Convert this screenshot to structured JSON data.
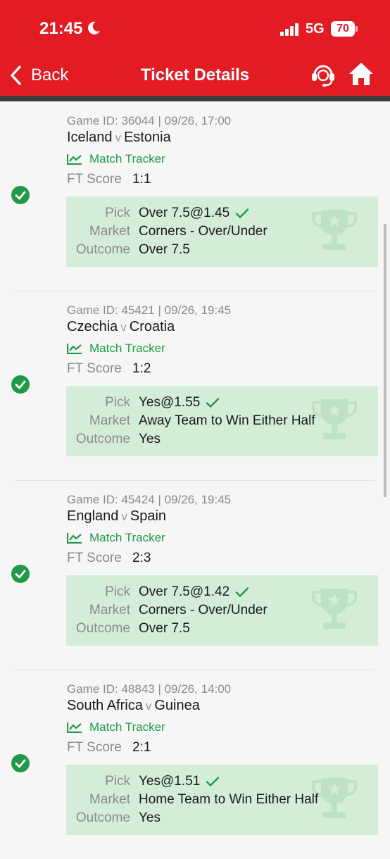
{
  "status_bar": {
    "time": "21:45",
    "network": "5G",
    "battery": "70"
  },
  "header": {
    "back_label": "Back",
    "title": "Ticket Details"
  },
  "bets": [
    {
      "game_info": "Game ID: 36044 | 09/26, 17:00",
      "home": "Iceland",
      "vs": "v",
      "away": "Estonia",
      "tracker_label": "Match Tracker",
      "ft_label": "FT Score",
      "ft_score": "1:1",
      "pick_label": "Pick",
      "pick": "Over 7.5@1.45",
      "market_label": "Market",
      "market": "Corners - Over/Under",
      "outcome_label": "Outcome",
      "outcome": "Over 7.5"
    },
    {
      "game_info": "Game ID: 45421 | 09/26, 19:45",
      "home": "Czechia",
      "vs": "v",
      "away": "Croatia",
      "tracker_label": "Match Tracker",
      "ft_label": "FT Score",
      "ft_score": "1:2",
      "pick_label": "Pick",
      "pick": "Yes@1.55",
      "market_label": "Market",
      "market": "Away Team to Win Either Half",
      "outcome_label": "Outcome",
      "outcome": "Yes"
    },
    {
      "game_info": "Game ID: 45424 | 09/26, 19:45",
      "home": "England",
      "vs": "v",
      "away": "Spain",
      "tracker_label": "Match Tracker",
      "ft_label": "FT Score",
      "ft_score": "2:3",
      "pick_label": "Pick",
      "pick": "Over 7.5@1.42",
      "market_label": "Market",
      "market": "Corners - Over/Under",
      "outcome_label": "Outcome",
      "outcome": "Over 7.5"
    },
    {
      "game_info": "Game ID: 48843 | 09/26, 14:00",
      "home": "South Africa",
      "vs": "v",
      "away": "Guinea",
      "tracker_label": "Match Tracker",
      "ft_label": "FT Score",
      "ft_score": "2:1",
      "pick_label": "Pick",
      "pick": "Yes@1.51",
      "market_label": "Market",
      "market": "Home Team to Win Either Half",
      "outcome_label": "Outcome",
      "outcome": "Yes"
    }
  ],
  "colors": {
    "brand": "#e31b23",
    "win_green": "#1f9a48",
    "pick_bg": "#d4edd9"
  }
}
